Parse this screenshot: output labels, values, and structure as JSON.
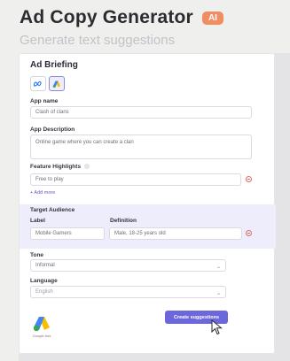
{
  "header": {
    "title": "Ad Copy Generator",
    "badge": "AI",
    "subtitle": "Generate text suggestions"
  },
  "card": {
    "title": "Ad Briefing",
    "platforms": [
      {
        "icon": "meta-icon",
        "selected": false
      },
      {
        "icon": "google-ads-icon",
        "selected": true
      }
    ],
    "app_name": {
      "label": "App name",
      "value": "Clash of clans"
    },
    "app_description": {
      "label": "App Description",
      "value": "Online game where you can create a clan"
    },
    "feature_highlights": {
      "label": "Feature Highlights",
      "items": [
        "Free to play"
      ],
      "add_more": "+ Add more"
    },
    "target_audience": {
      "section_title": "Target Audience",
      "label_header": "Label",
      "definition_header": "Definition",
      "label_value": "Mobile Gamers",
      "definition_value": "Male, 18-25 years old"
    },
    "tone": {
      "label": "Tone",
      "value": "Informal"
    },
    "language": {
      "label": "Language",
      "value": "English"
    },
    "create_button": "Create suggestions",
    "google_label": "Google Ads"
  },
  "colors": {
    "accent": "#6d67dc",
    "badge": "#f08d63",
    "remove": "#e06a6a",
    "band": "#eeedfb"
  }
}
